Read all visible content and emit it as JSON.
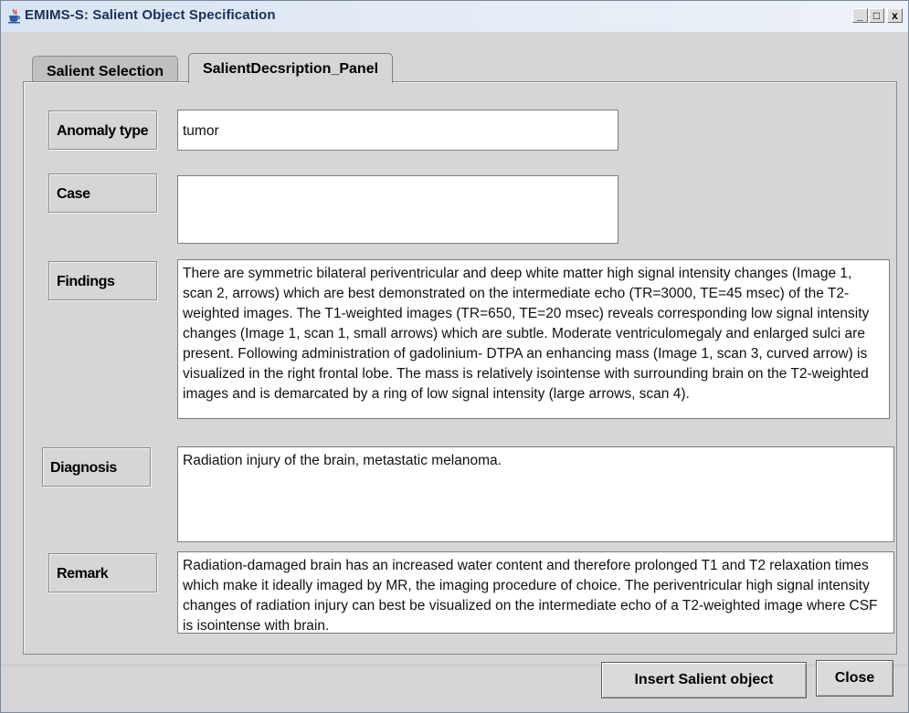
{
  "window": {
    "title": "EMIMS-S: Salient Object Specification",
    "controls": {
      "minimize": "_",
      "maximize": "□",
      "close": "x"
    }
  },
  "tabs": [
    {
      "label": "Salient Selection",
      "selected": false
    },
    {
      "label": "SalientDecsription_Panel",
      "selected": true
    }
  ],
  "form": {
    "anomaly_type": {
      "label": "Anomaly type",
      "value": "tumor"
    },
    "case": {
      "label": "Case",
      "value": ""
    },
    "findings": {
      "label": "Findings",
      "value": "There are symmetric bilateral periventricular and deep white matter high signal intensity changes (Image 1, scan 2, arrows) which are best demonstrated on the intermediate echo (TR=3000, TE=45 msec) of the T2-weighted images. The T1-weighted images (TR=650, TE=20 msec) reveals corresponding low signal intensity changes (Image 1, scan 1, small arrows) which are subtle. Moderate ventriculomegaly and enlarged sulci are present. Following administration of gadolinium- DTPA an enhancing mass (Image 1, scan 3, curved arrow) is visualized in the right frontal lobe. The mass is relatively isointense with surrounding brain on the T2-weighted images and is demarcated by a ring of low signal intensity (large arrows, scan 4)."
    },
    "diagnosis": {
      "label": "Diagnosis",
      "value": "Radiation injury of the brain, metastatic melanoma."
    },
    "remark": {
      "label": "Remark",
      "value": "Radiation-damaged brain has an increased water content and therefore prolonged T1 and T2 relaxation times which make it ideally imaged by MR, the imaging procedure of choice. The periventricular high signal intensity changes of radiation injury can best be visualized on the intermediate echo of a T2-weighted image where CSF is isointense with brain."
    }
  },
  "buttons": {
    "insert": "Insert Salient object",
    "close": "Close"
  },
  "colors": {
    "titlebar_text": "#1b2f58",
    "panel_bg": "#d6d6d6",
    "field_bg": "#ffffff"
  },
  "icons": {
    "app": "java-coffee-cup-icon"
  }
}
